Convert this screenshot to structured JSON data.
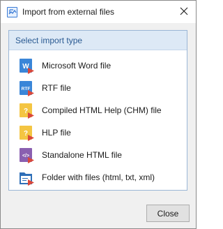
{
  "window": {
    "title": "Import from external files",
    "icon": "import-app-icon"
  },
  "group": {
    "header": "Select import type",
    "items": [
      {
        "label": "Microsoft Word file",
        "icon": "word-file-icon",
        "color": "#3a86d8",
        "badge": "W"
      },
      {
        "label": "RTF file",
        "icon": "rtf-file-icon",
        "color": "#3a86d8",
        "badge": "RTF"
      },
      {
        "label": "Compiled HTML Help (CHM) file",
        "icon": "chm-file-icon",
        "color": "#f4c542",
        "badge": "?"
      },
      {
        "label": "HLP file",
        "icon": "hlp-file-icon",
        "color": "#f4c542",
        "badge": "?"
      },
      {
        "label": "Standalone HTML file",
        "icon": "html-file-icon",
        "color": "#8a5fb0",
        "badge": "</>"
      },
      {
        "label": "Folder with files (html, txt, xml)",
        "icon": "folder-files-icon",
        "color": "#2f6fb8",
        "badge": ""
      }
    ]
  },
  "footer": {
    "close_label": "Close"
  },
  "colors": {
    "accent_red": "#d9483b",
    "header_bg": "#dde9f6",
    "header_text": "#2a5a92"
  }
}
